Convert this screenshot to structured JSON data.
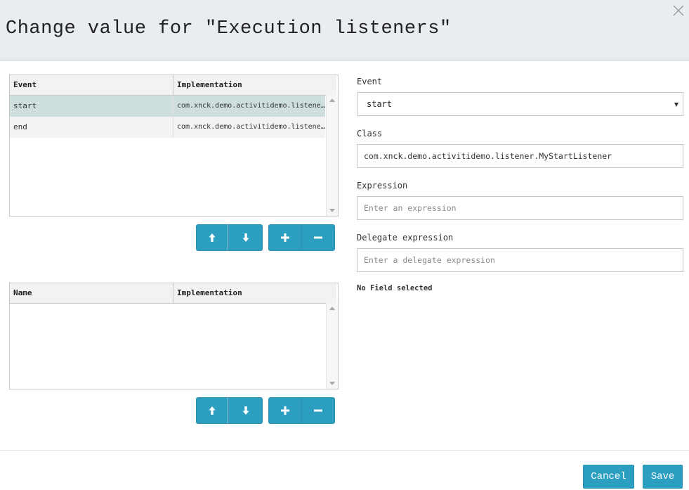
{
  "dialog": {
    "title": "Change value for \"Execution listeners\""
  },
  "listeners_grid": {
    "headers": [
      "Event",
      "Implementation"
    ],
    "rows": [
      {
        "event": "start",
        "implementation": "com.xnck.demo.activitidemo.listener.MyStartListener"
      },
      {
        "event": "end",
        "implementation": "com.xnck.demo.activitidemo.listener.MyEndListener"
      }
    ]
  },
  "fields_grid": {
    "headers": [
      "Name",
      "Implementation"
    ]
  },
  "form": {
    "event_label": "Event",
    "event_value": "start",
    "class_label": "Class",
    "class_value": "com.xnck.demo.activitidemo.listener.MyStartListener",
    "expression_label": "Expression",
    "expression_placeholder": "Enter an expression",
    "delegate_label": "Delegate expression",
    "delegate_placeholder": "Enter a delegate expression",
    "no_field_text": "No Field selected"
  },
  "footer": {
    "cancel_label": "Cancel",
    "save_label": "Save"
  },
  "colors": {
    "accent": "#2c9ec0",
    "selected_row": "#cfdede",
    "header_bg": "#e9ecf0"
  },
  "icons": [
    "close-icon",
    "arrow-up-icon",
    "arrow-down-icon",
    "plus-icon",
    "minus-icon",
    "chevron-down-icon"
  ]
}
